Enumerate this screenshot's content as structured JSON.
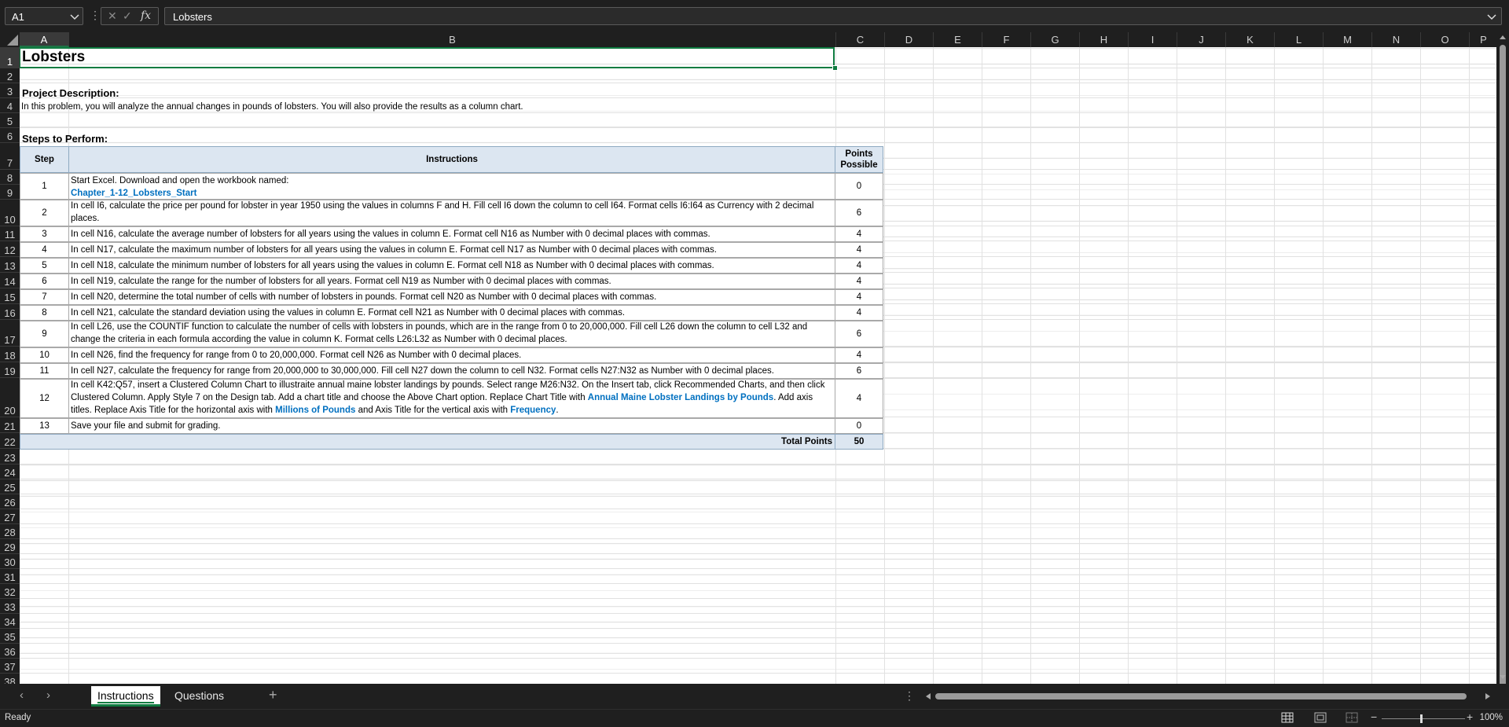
{
  "formula_bar": {
    "name_box": "A1",
    "formula": "Lobsters"
  },
  "columns": [
    "A",
    "B",
    "C",
    "D",
    "E",
    "F",
    "G",
    "H",
    "I",
    "J",
    "K",
    "L",
    "M",
    "N",
    "O",
    "P"
  ],
  "rows": [
    "1",
    "2",
    "3",
    "4",
    "5",
    "6",
    "7",
    "8",
    "9",
    "10",
    "11",
    "12",
    "13",
    "14",
    "15",
    "16",
    "17",
    "18",
    "19",
    "20",
    "21",
    "22",
    "23",
    "24",
    "25",
    "26",
    "27",
    "28",
    "29",
    "30",
    "31",
    "32",
    "33",
    "34",
    "35",
    "36",
    "37",
    "38"
  ],
  "sheet": {
    "title": "Lobsters",
    "project_description_label": "Project Description:",
    "project_description": "In this problem, you will analyze the annual changes in pounds of lobsters.  You will also provide the results as a column chart.",
    "steps_label": "Steps to Perform:",
    "table_headers": {
      "step": "Step",
      "instructions": "Instructions",
      "points": "Points Possible"
    },
    "steps": [
      {
        "step": "1",
        "text": "Start Excel. Download and open the workbook named:",
        "link": "Chapter_1-12_Lobsters_Start",
        "points": "0"
      },
      {
        "step": "2",
        "text": "In cell I6, calculate the price per pound for lobster in year 1950 using the values in columns F and H. Fill cell I6 down the column to cell I64. Format cells I6:I64 as Currency with 2 decimal places.",
        "points": "6"
      },
      {
        "step": "3",
        "text": "In cell N16, calculate the average number of lobsters for all years using the values in column E. Format cell N16 as Number with 0 decimal places with commas.",
        "points": "4"
      },
      {
        "step": "4",
        "text": "In cell N17, calculate the maximum number of lobsters for all years using the values in column E. Format cell N17 as Number with 0 decimal places with commas.",
        "points": "4"
      },
      {
        "step": "5",
        "text": "In cell N18, calculate the minimum number of lobsters for all years using the values in column E. Format cell N18 as Number with 0 decimal places with commas.",
        "points": "4"
      },
      {
        "step": "6",
        "text": "In cell N19, calculate the range for the number of lobsters for all years. Format cell N19 as Number with 0 decimal places with commas.",
        "points": "4"
      },
      {
        "step": "7",
        "text": "In cell N20, determine the total number of cells with number of lobsters in pounds. Format cell N20 as Number with 0 decimal places with commas.",
        "points": "4"
      },
      {
        "step": "8",
        "text": "In cell N21, calculate the standard deviation using the values in column E. Format cell N21 as Number with 0 decimal places with commas.",
        "points": "4"
      },
      {
        "step": "9",
        "text": "In cell L26, use the COUNTIF function to calculate the number of cells with lobsters in pounds, which are in the range from 0 to 20,000,000. Fill cell L26 down the column to cell L32 and change the criteria in each formula according the value in column K. Format cells L26:L32 as Number with 0 decimal places.",
        "points": "6"
      },
      {
        "step": "10",
        "text": "In cell N26, find the frequency for range from 0 to 20,000,000. Format cell N26 as Number with 0 decimal places.",
        "points": "4"
      },
      {
        "step": "11",
        "text": "In cell N27, calculate the frequency for range from 20,000,000 to 30,000,000. Fill cell N27 down the column to cell N32. Format cells N27:N32 as Number with 0 decimal places.",
        "points": "6"
      },
      {
        "step": "12",
        "text_a": "In cell K42:Q57, insert a Clustered Column Chart to illustraite annual maine lobster landings by pounds. Select range M26:N32. On the Insert tab, click Recommended Charts, and then click Clustered Column. Apply Style 7 on the Design tab. Add a chart title and choose the Above Chart option. Replace Chart Title with ",
        "link_a": "Annual Maine Lobster Landings by Pounds",
        "text_b": ". Add axis titles. Replace Axis Title for the horizontal axis with ",
        "link_b": "Millions of Pounds",
        "text_c": " and Axis Title for the vertical axis with ",
        "link_c": "Frequency",
        "text_d": ".",
        "points": "4"
      },
      {
        "step": "13",
        "text": "Save your file and submit for grading.",
        "points": "0"
      }
    ],
    "total_label": "Total Points",
    "total_value": "50"
  },
  "tabs": [
    {
      "label": "Instructions",
      "active": true
    },
    {
      "label": "Questions",
      "active": false
    }
  ],
  "status": {
    "text": "Ready",
    "zoom": "100%"
  },
  "colors": {
    "accent": "#107c41",
    "header_fill": "#dce6f1",
    "link": "#0070c0"
  }
}
